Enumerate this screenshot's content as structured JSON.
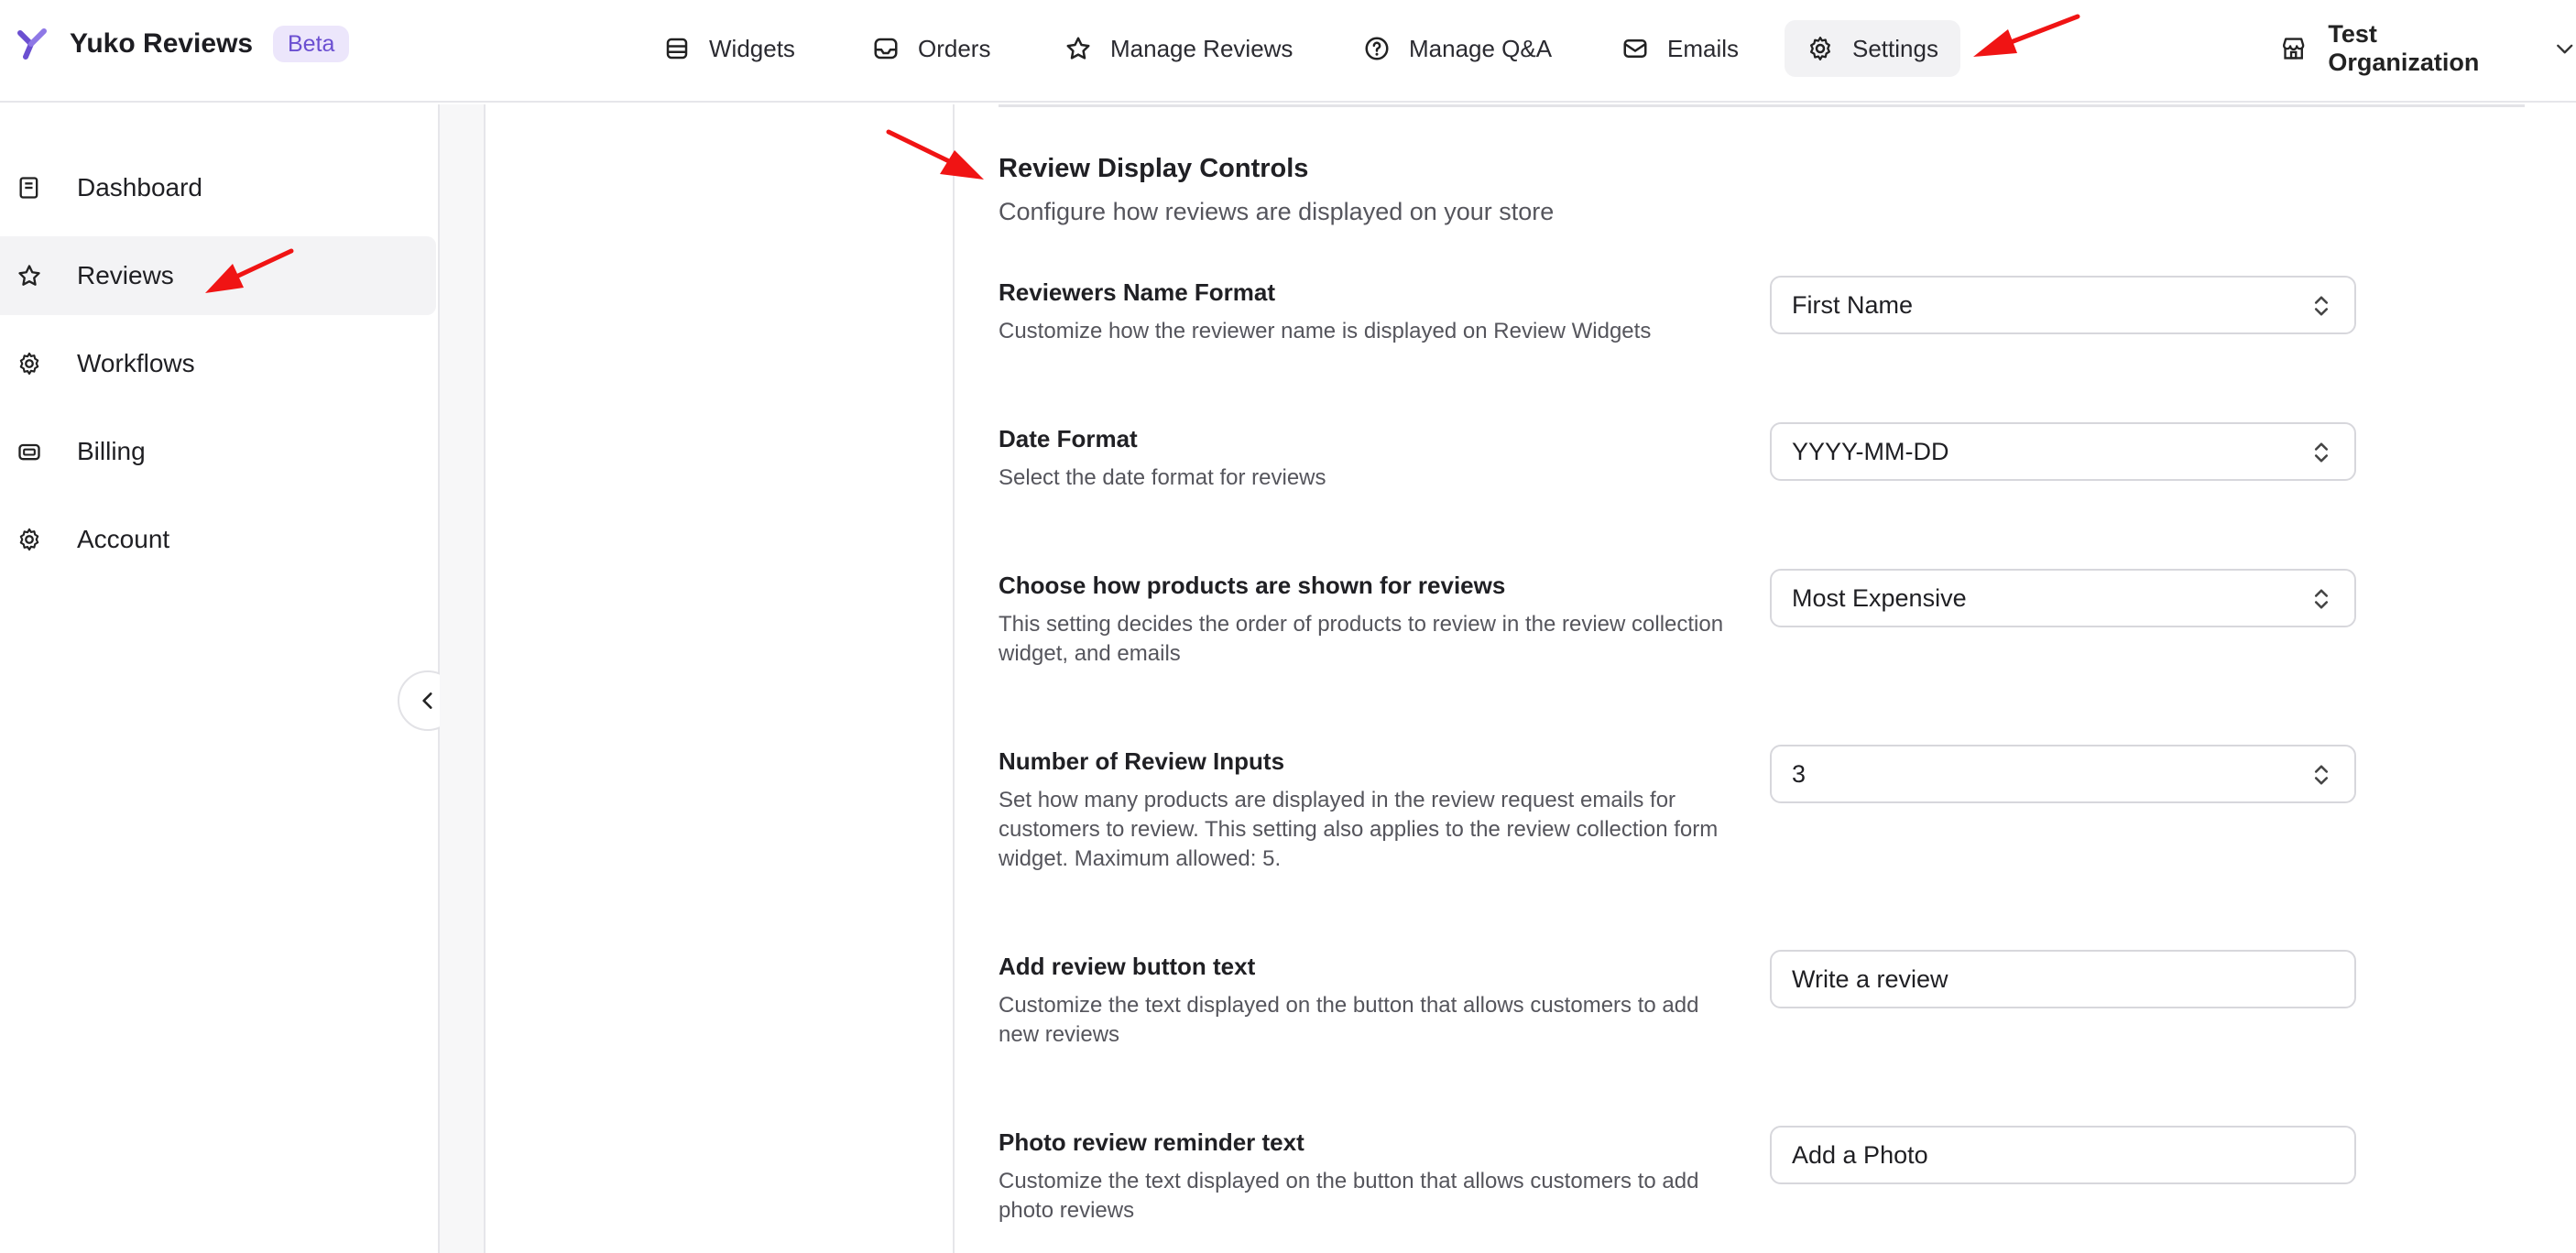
{
  "app": {
    "name": "Yuko Reviews",
    "badge": "Beta"
  },
  "nav": {
    "widgets": "Widgets",
    "orders": "Orders",
    "manage_reviews": "Manage Reviews",
    "manage_qa": "Manage Q&A",
    "emails": "Emails",
    "settings": "Settings",
    "active": "Settings"
  },
  "org": {
    "name": "Test Organization"
  },
  "sidebar": {
    "items": [
      {
        "label": "Dashboard",
        "icon": "book-icon"
      },
      {
        "label": "Reviews",
        "icon": "star-icon",
        "active": true
      },
      {
        "label": "Workflows",
        "icon": "gear-icon"
      },
      {
        "label": "Billing",
        "icon": "card-icon"
      },
      {
        "label": "Account",
        "icon": "gear-icon"
      }
    ]
  },
  "section": {
    "title": "Review Display Controls",
    "subtitle": "Configure how reviews are displayed on your store"
  },
  "settings": {
    "name_format": {
      "title": "Reviewers Name Format",
      "desc": "Customize how the reviewer name is displayed on Review Widgets",
      "value": "First Name"
    },
    "date_format": {
      "title": "Date Format",
      "desc": "Select the date format for reviews",
      "value": "YYYY-MM-DD"
    },
    "product_order": {
      "title": "Choose how products are shown for reviews",
      "desc": "This setting decides the order of products to review in the review collection widget, and emails",
      "value": "Most Expensive"
    },
    "review_inputs": {
      "title": "Number of Review Inputs",
      "desc": "Set how many products are displayed in the review request emails for customers to review. This setting also applies to the review collection form widget. Maximum allowed: 5.",
      "value": "3"
    },
    "add_button_text": {
      "title": "Add review button text",
      "desc": "Customize the text displayed on the button that allows customers to add new reviews",
      "value": "Write a review"
    },
    "photo_reminder": {
      "title": "Photo review reminder text",
      "desc": "Customize the text displayed on the button that allows customers to add photo reviews",
      "value": "Add a Photo"
    }
  },
  "colors": {
    "accent": "#6b4fd1",
    "annotation": "#f01414",
    "border": "#d7d7dc"
  }
}
